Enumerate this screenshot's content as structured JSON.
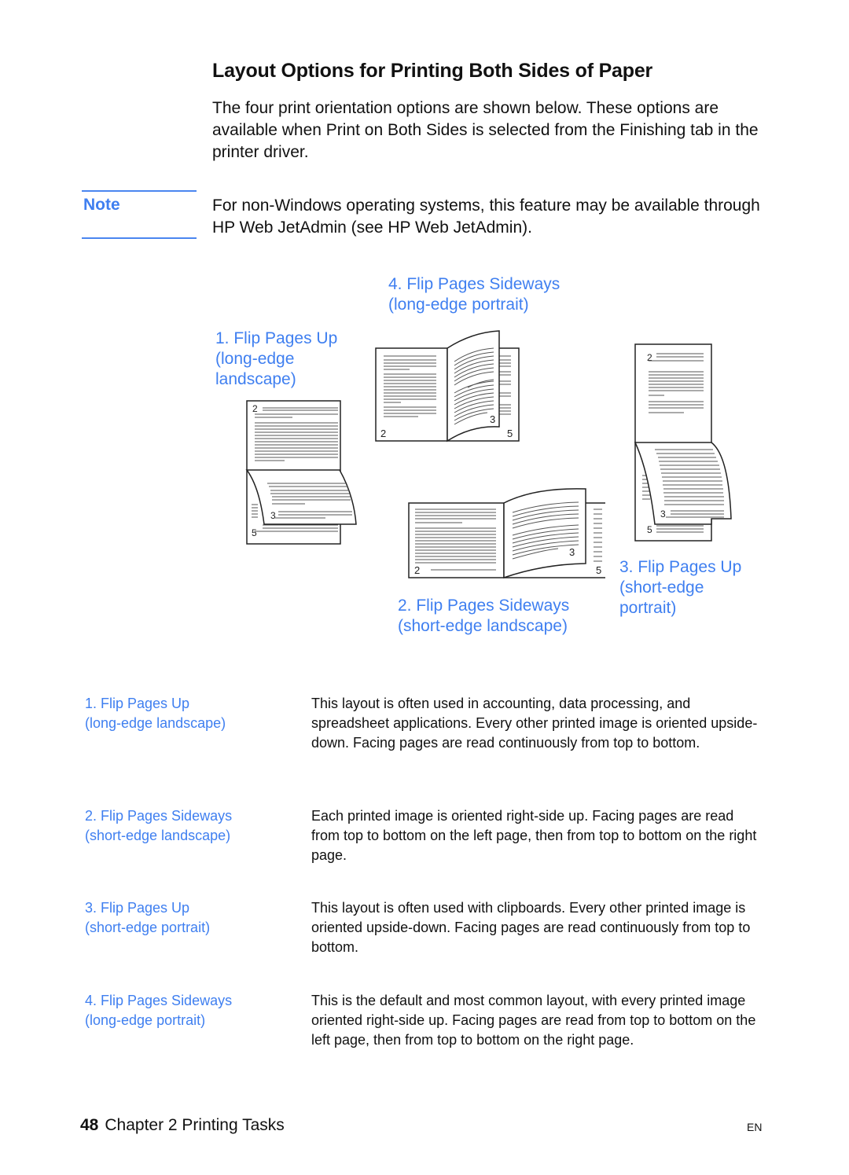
{
  "page": {
    "title": "Layout Options for Printing Both Sides of Paper",
    "intro": "The four print orientation options are shown below. These options are available when Print on Both Sides is selected from the Finishing tab in the printer driver.",
    "note": {
      "label": "Note",
      "text": "For non-Windows operating systems, this feature may be available through HP Web JetAdmin (see HP Web JetAdmin)."
    },
    "figure": {
      "captions": {
        "opt1": {
          "line1": "1. Flip Pages Up",
          "line2": "(long-edge",
          "line3": "landscape)"
        },
        "opt2": {
          "line1": "2. Flip Pages Sideways",
          "line2": "(short-edge landscape)"
        },
        "opt3": {
          "line1": "3. Flip Pages Up",
          "line2": "(short-edge",
          "line3": "portrait)"
        },
        "opt4": {
          "line1": "4. Flip Pages Sideways",
          "line2": "(long-edge portrait)"
        }
      },
      "page_numbers": {
        "first": "2",
        "second": "3",
        "third": "5"
      }
    },
    "options": [
      {
        "name": "1. Flip Pages Up",
        "subtitle": "(long-edge landscape)",
        "description": "This layout is often used in accounting, data processing, and spreadsheet applications. Every other printed image is oriented upside-down. Facing pages are read continuously from top to bottom."
      },
      {
        "name": "2. Flip Pages Sideways",
        "subtitle": "(short-edge landscape)",
        "description": "Each printed image is oriented right-side up. Facing pages are read from top to bottom on the left page, then from top to bottom on the right page."
      },
      {
        "name": "3. Flip Pages Up",
        "subtitle": "(short-edge portrait)",
        "description": "This layout is often used with clipboards. Every other printed image is oriented upside-down. Facing pages are read continuously from top to bottom."
      },
      {
        "name": "4. Flip Pages Sideways",
        "subtitle": "(long-edge portrait)",
        "description": "This is the default and most common layout, with every printed image oriented right-side up. Facing pages are read from top to bottom on the left page, then from top to bottom on the right page."
      }
    ],
    "footer": {
      "page_number": "48",
      "chapter": "Chapter 2 Printing Tasks",
      "language": "EN"
    }
  }
}
